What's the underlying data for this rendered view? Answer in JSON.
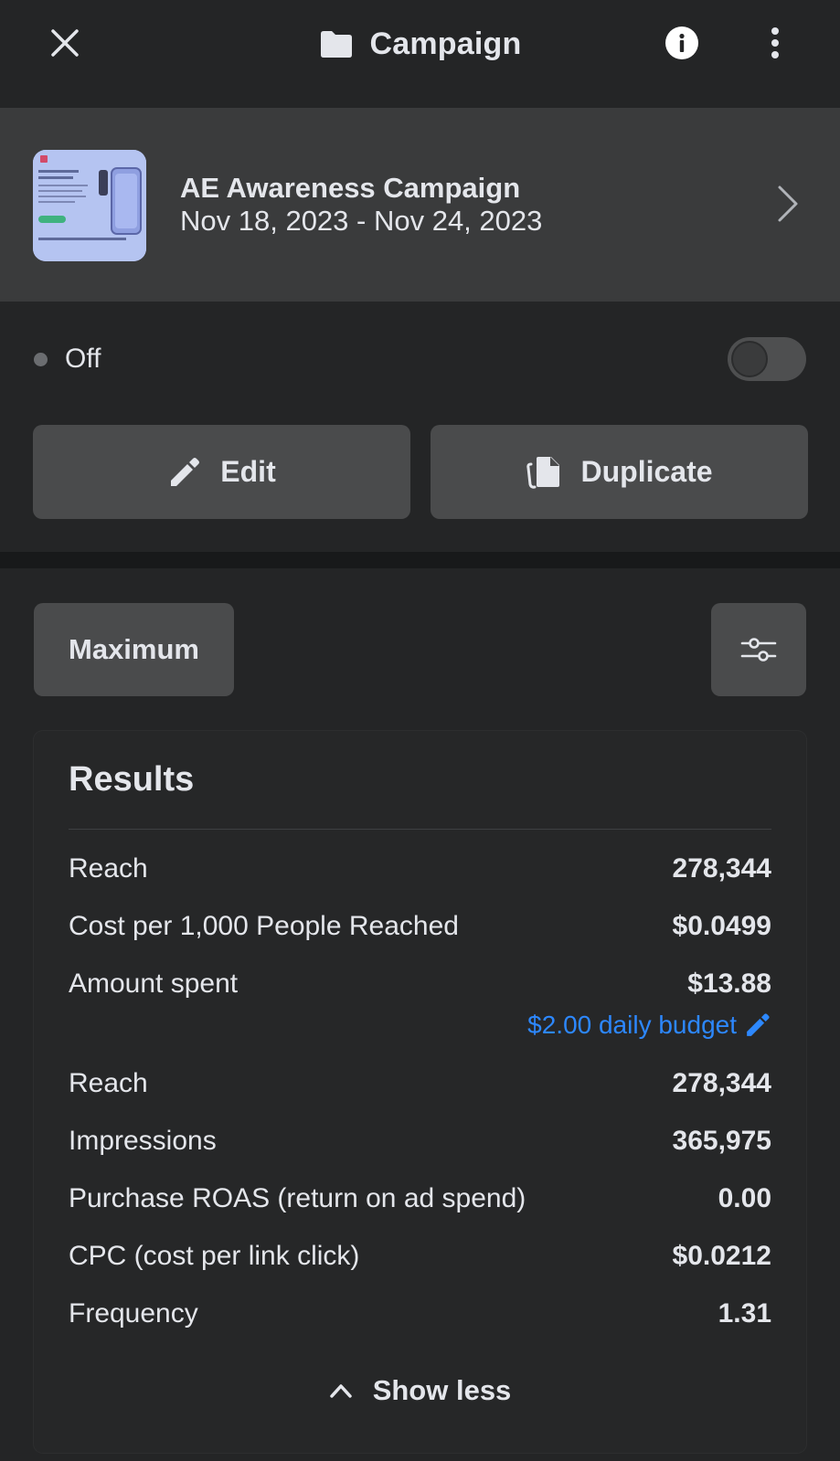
{
  "header": {
    "title": "Campaign",
    "icons": {
      "close": "close-icon",
      "folder": "folder-icon",
      "info": "info-icon",
      "more": "more-vertical-icon"
    }
  },
  "campaign": {
    "name": "AE Awareness Campaign",
    "dates": "Nov 18, 2023 - Nov 24, 2023"
  },
  "status": {
    "label": "Off",
    "enabled": false
  },
  "actions": {
    "edit_label": "Edit",
    "duplicate_label": "Duplicate"
  },
  "filters": {
    "preset_label": "Maximum"
  },
  "results": {
    "title": "Results",
    "metrics": [
      {
        "label": "Reach",
        "value": "278,344"
      },
      {
        "label": "Cost per 1,000 People Reached",
        "value": "$0.0499"
      },
      {
        "label": "Amount spent",
        "value": "$13.88"
      },
      {
        "label": "Reach",
        "value": "278,344"
      },
      {
        "label": "Impressions",
        "value": "365,975"
      },
      {
        "label": "Purchase ROAS (return on ad spend)",
        "value": "0.00"
      },
      {
        "label": "CPC (cost per link click)",
        "value": "$0.0212"
      },
      {
        "label": "Frequency",
        "value": "1.31"
      }
    ],
    "budget_text": "$2.00 daily budget",
    "show_less_label": "Show less"
  },
  "colors": {
    "background": "#242526",
    "card": "#3a3b3c",
    "button": "#4a4b4c",
    "link": "#2d88ff",
    "text": "#e4e6eb"
  }
}
